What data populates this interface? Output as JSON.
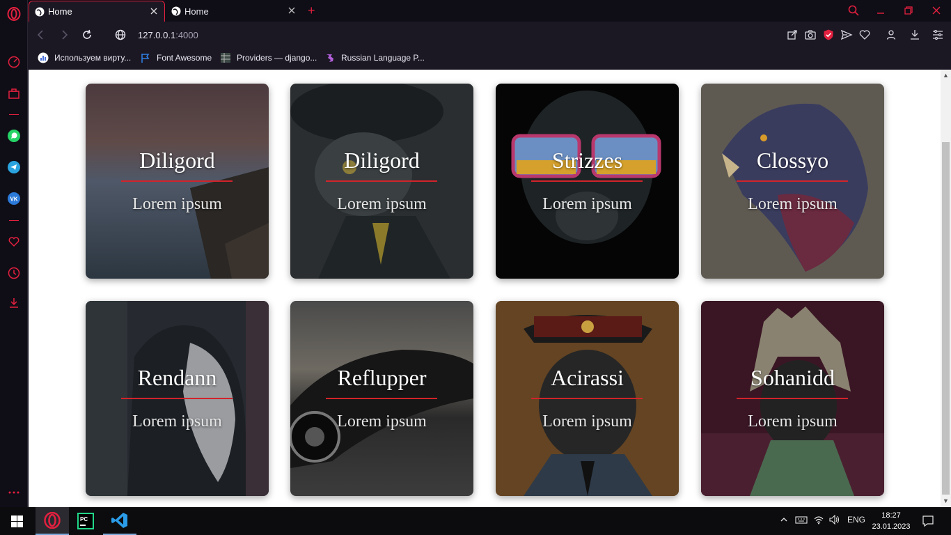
{
  "browser": {
    "tabs": [
      {
        "label": "Home",
        "active": true
      },
      {
        "label": "Home",
        "active": false
      }
    ],
    "url_host": "127.0.0.1",
    "url_port": ":4000",
    "bookmarks": [
      {
        "label": "Используем вирту...",
        "icon": "chart-icon",
        "color": "#ffffff"
      },
      {
        "label": "Font Awesome",
        "icon": "flag-icon",
        "color": "#2f7de1"
      },
      {
        "label": "Providers — django...",
        "icon": "table-icon",
        "color": "#b8b8b8"
      },
      {
        "label": "Russian Language P...",
        "icon": "puzzle-icon",
        "color": "#b25fd8"
      }
    ]
  },
  "cards": [
    {
      "title": "Diligord",
      "subtitle": "Lorem ipsum",
      "bg": "seascape"
    },
    {
      "title": "Diligord",
      "subtitle": "Lorem ipsum",
      "bg": "suit-character"
    },
    {
      "title": "Strizzes",
      "subtitle": "Lorem ipsum",
      "bg": "gorilla-sunglasses"
    },
    {
      "title": "Clossyo",
      "subtitle": "Lorem ipsum",
      "bg": "eagle"
    },
    {
      "title": "Rendann",
      "subtitle": "Lorem ipsum",
      "bg": "masked-figure"
    },
    {
      "title": "Reflupper",
      "subtitle": "Lorem ipsum",
      "bg": "sports-car"
    },
    {
      "title": "Acirassi",
      "subtitle": "Lorem ipsum",
      "bg": "gasmask-officer"
    },
    {
      "title": "Sohanidd",
      "subtitle": "Lorem ipsum",
      "bg": "headdress-warrior"
    }
  ],
  "taskbar": {
    "apps": [
      "opera-icon",
      "pycharm-icon",
      "vscode-icon"
    ],
    "language": "ENG",
    "time": "18:27",
    "date": "23.01.2023"
  },
  "colors": {
    "accent": "#e3203f",
    "card_underline": "#d2232a"
  }
}
